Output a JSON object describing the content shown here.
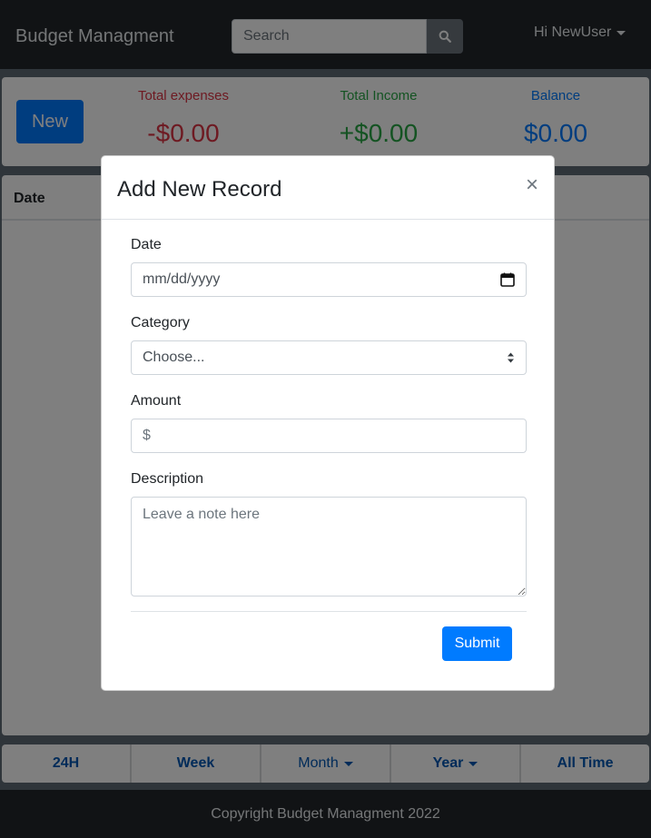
{
  "navbar": {
    "brand": "Budget Managment",
    "search_placeholder": "Search",
    "search_icon": "search-icon",
    "user_label": "Hi NewUser"
  },
  "summary": {
    "new_button": "New",
    "expenses_label": "Total expenses",
    "expenses_value": "-$0.00",
    "income_label": "Total Income",
    "income_value": "+$0.00",
    "balance_label": "Balance",
    "balance_value": "$0.00",
    "colors": {
      "expenses": "#dc3545",
      "income": "#28a745",
      "balance": "#007bff"
    }
  },
  "table": {
    "columns": [
      "Date"
    ]
  },
  "filters": [
    {
      "label": "24H"
    },
    {
      "label": "Week"
    },
    {
      "label": "Month"
    },
    {
      "label": "Year"
    },
    {
      "label": "All Time"
    }
  ],
  "footer": {
    "text": "Copyright Budget Managment 2022"
  },
  "modal": {
    "title": "Add New Record",
    "close_glyph": "×",
    "date_label": "Date",
    "date_placeholder": "mm/dd/yyyy",
    "date_icon": "calendar-icon",
    "category_label": "Category",
    "category_selected": "Choose...",
    "amount_label": "Amount",
    "amount_placeholder": "$",
    "description_label": "Description",
    "description_placeholder": "Leave a note here",
    "submit_label": "Submit"
  }
}
